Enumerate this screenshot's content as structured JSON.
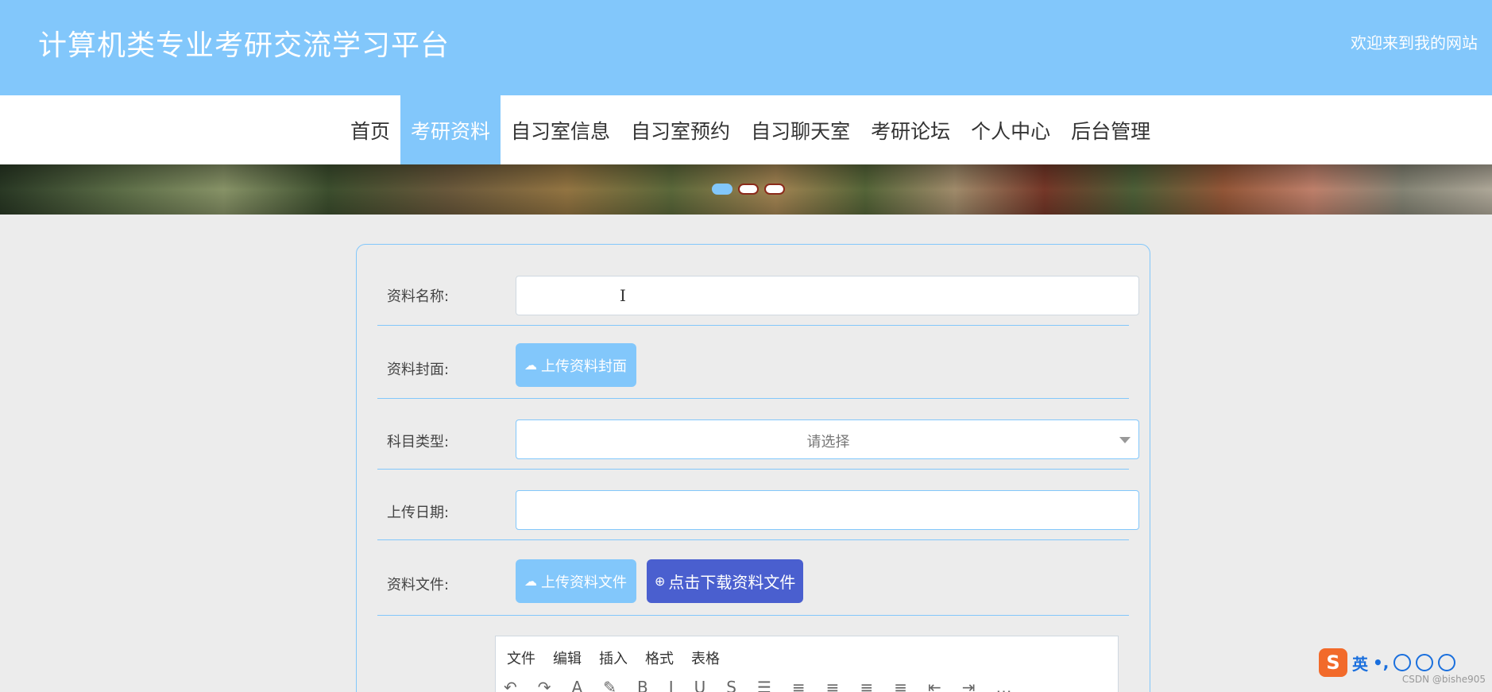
{
  "header": {
    "title": "计算机类专业考研交流学习平台",
    "welcome": "欢迎来到我的网站"
  },
  "nav": {
    "items": [
      {
        "label": "首页"
      },
      {
        "label": "考研资料"
      },
      {
        "label": "自习室信息"
      },
      {
        "label": "自习室预约"
      },
      {
        "label": "自习聊天室"
      },
      {
        "label": "考研论坛"
      },
      {
        "label": "个人中心"
      },
      {
        "label": "后台管理"
      }
    ],
    "active_index": 1
  },
  "banner": {
    "slide_count": 3,
    "active_slide": 0
  },
  "form": {
    "name_label": "资料名称:",
    "name_value": "",
    "cover_label": "资料封面:",
    "cover_button": "上传资料封面",
    "subject_label": "科目类型:",
    "subject_placeholder": "请选择",
    "date_label": "上传日期:",
    "date_value": "",
    "file_label": "资料文件:",
    "file_upload_button": "上传资料文件",
    "file_download_button": "点击下载资料文件"
  },
  "editor": {
    "menu": [
      "文件",
      "编辑",
      "插入",
      "格式",
      "表格"
    ]
  },
  "ime": {
    "logo": "S",
    "mode": "英"
  },
  "watermark": "CSDN @bishe905",
  "colors": {
    "accent": "#82c7fb",
    "download_button": "#4a5fcf",
    "background": "#ececec"
  }
}
